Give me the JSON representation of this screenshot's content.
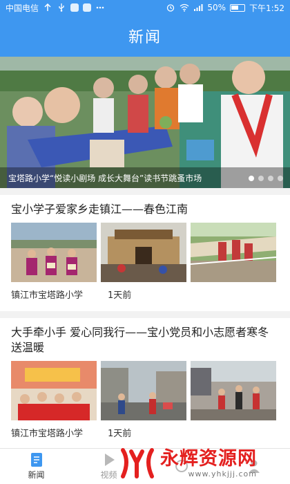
{
  "status_bar": {
    "carrier": "中国电信",
    "battery": "50%",
    "time": "下午1:52"
  },
  "header": {
    "title": "新闻"
  },
  "banner": {
    "caption": "宝塔路小学“悦读小剧场 成长大舞台”读书节跳蚤市场",
    "dot_count": 4,
    "active_dot": 1
  },
  "news": [
    {
      "title": "宝小学子爱家乡走镇江——春色江南",
      "source": "镇江市宝塔路小学",
      "time": "1天前"
    },
    {
      "title": "大手牵小手 爱心同我行——宝小党员和小志愿者寒冬送温暖",
      "source": "镇江市宝塔路小学",
      "time": "1天前"
    }
  ],
  "tabs": [
    {
      "label": "新闻",
      "icon": "document-icon",
      "active": true
    },
    {
      "label": "视频",
      "icon": "play-icon",
      "active": false
    },
    {
      "label": "",
      "icon": "circle-icon",
      "active": false
    },
    {
      "label": "",
      "icon": "user-icon",
      "active": false
    }
  ],
  "watermark": {
    "text": "永辉资源网",
    "url": "www.yhkjjj.com",
    "color": "#e4201f"
  },
  "colors": {
    "accent": "#3e97f0"
  }
}
